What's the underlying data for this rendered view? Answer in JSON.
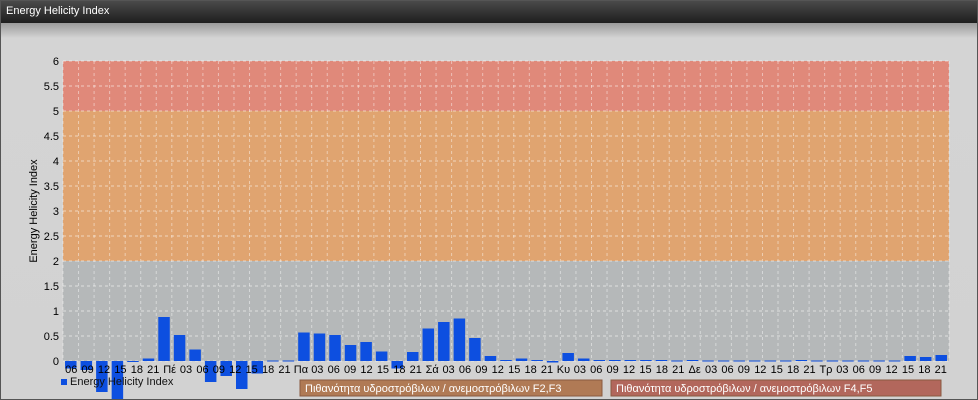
{
  "window": {
    "title": "Energy Helicity Index"
  },
  "chart_data": {
    "type": "bar",
    "ylabel": "Energy Helicity Index",
    "ylim": [
      0,
      6
    ],
    "yticks": [
      0,
      0.5,
      1,
      1.5,
      2,
      2.5,
      3,
      3.5,
      4,
      4.5,
      5,
      5.5,
      6
    ],
    "bands": [
      {
        "from": 0,
        "to": 2,
        "color": "#b5b8b9"
      },
      {
        "from": 2,
        "to": 5,
        "color": "#e0a470"
      },
      {
        "from": 5,
        "to": 6,
        "color": "#e0897a"
      }
    ],
    "x_tick_labels": [
      "06",
      "09",
      "12",
      "15",
      "18",
      "21",
      "Πέ",
      "03",
      "06",
      "09",
      "12",
      "15",
      "18",
      "21",
      "Πα",
      "03",
      "06",
      "09",
      "12",
      "15",
      "18",
      "21",
      "Σά",
      "03",
      "06",
      "09",
      "12",
      "15",
      "18",
      "21",
      "Κυ",
      "03",
      "06",
      "09",
      "12",
      "15",
      "18",
      "21",
      "Δε",
      "03",
      "06",
      "09",
      "12",
      "15",
      "18",
      "21",
      "Τρ",
      "03",
      "06",
      "09",
      "12",
      "15",
      "18",
      "21"
    ],
    "series": [
      {
        "name": "Energy Helicity Index",
        "color": "#0d4fe0",
        "values": [
          -0.15,
          -0.18,
          -0.62,
          -0.78,
          -0.02,
          0.05,
          0.88,
          0.52,
          0.23,
          -0.42,
          -0.3,
          -0.56,
          -0.25,
          0.01,
          0.01,
          0.57,
          0.55,
          0.52,
          0.32,
          0.38,
          0.19,
          -0.15,
          0.18,
          0.65,
          0.78,
          0.85,
          0.46,
          0.1,
          0.02,
          0.05,
          0.02,
          -0.03,
          0.16,
          0.05,
          0.02,
          0.02,
          0.02,
          0.02,
          0.02,
          0.01,
          0.02,
          0.01,
          0.01,
          0.01,
          0.01,
          0.01,
          0.01,
          0.02,
          0.01,
          0.01,
          0.01,
          0.01,
          0.01,
          0.01,
          0.1,
          0.08,
          0.12
        ]
      }
    ],
    "legend": {
      "label": "Energy Helicity Index",
      "placement": "bottom-left"
    },
    "risk_buttons": [
      {
        "label": "Πιθανότητα υδροστρόβιλων / ανεμοστρόβιλων F2,F3",
        "color": "#b07a55"
      },
      {
        "label": "Πιθανότητα υδροστρόβιλων / ανεμοστρόβιλων F4,F5",
        "color": "#b2675c"
      }
    ]
  }
}
